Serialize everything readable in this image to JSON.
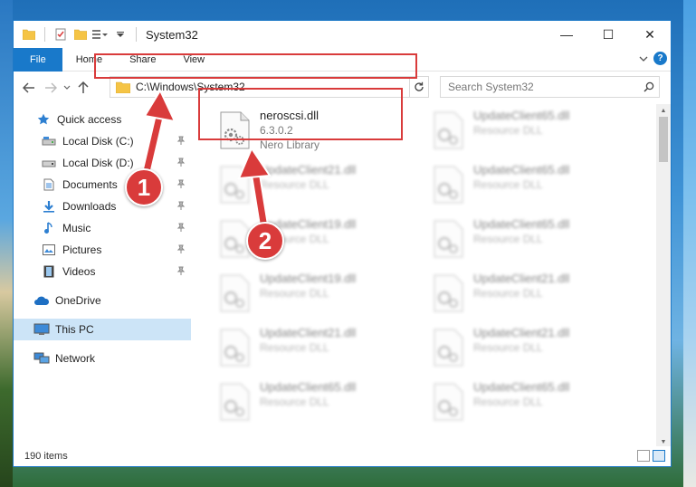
{
  "window": {
    "title": "System32",
    "controls": {
      "minimize": "—",
      "maximize": "☐",
      "close": "✕"
    }
  },
  "ribbon": {
    "tabs": [
      "File",
      "Home",
      "Share",
      "View"
    ],
    "help": "?"
  },
  "navigation": {
    "address": "C:\\Windows\\System32",
    "search_placeholder": "Search System32"
  },
  "sidebar": {
    "items": [
      {
        "label": "Quick access",
        "icon": "star-icon"
      },
      {
        "label": "Local Disk (C:)",
        "icon": "drive-icon",
        "pinned": true
      },
      {
        "label": "Local Disk (D:)",
        "icon": "drive-icon",
        "pinned": true
      },
      {
        "label": "Documents",
        "icon": "documents-icon",
        "pinned": true
      },
      {
        "label": "Downloads",
        "icon": "download-icon",
        "pinned": true
      },
      {
        "label": "Music",
        "icon": "music-icon",
        "pinned": true
      },
      {
        "label": "Pictures",
        "icon": "pictures-icon",
        "pinned": true
      },
      {
        "label": "Videos",
        "icon": "videos-icon",
        "pinned": true
      },
      {
        "label": "OneDrive",
        "icon": "cloud-icon"
      },
      {
        "label": "This PC",
        "icon": "computer-icon",
        "selected": true
      },
      {
        "label": "Network",
        "icon": "network-icon"
      }
    ]
  },
  "files": {
    "highlighted": {
      "name": "neroscsi.dll",
      "version": "6.3.0.2",
      "type": "Nero Library"
    },
    "left_column": [
      {
        "name": "UpdateClient21.dll",
        "type": "Resource DLL"
      },
      {
        "name": "UpdateClient19.dll",
        "type": "Resource DLL"
      },
      {
        "name": "UpdateClient19.dll",
        "type": "Resource DLL"
      },
      {
        "name": "UpdateClient21.dll",
        "type": "Resource DLL"
      },
      {
        "name": "UpdateClient65.dll",
        "type": "Resource DLL"
      }
    ],
    "right_column": [
      {
        "name": "UpdateClient65.dll",
        "type": "Resource DLL"
      },
      {
        "name": "UpdateClient65.dll",
        "type": "Resource DLL"
      },
      {
        "name": "UpdateClient65.dll",
        "type": "Resource DLL"
      },
      {
        "name": "UpdateClient21.dll",
        "type": "Resource DLL"
      },
      {
        "name": "UpdateClient21.dll",
        "type": "Resource DLL"
      },
      {
        "name": "UpdateClient65.dll",
        "type": "Resource DLL"
      }
    ]
  },
  "status": {
    "item_count": "190 items"
  },
  "annotations": {
    "step1": "1",
    "step2": "2"
  },
  "colors": {
    "accent": "#1979ca",
    "highlight": "#d93b3b",
    "selected_bg": "#cce4f7"
  }
}
